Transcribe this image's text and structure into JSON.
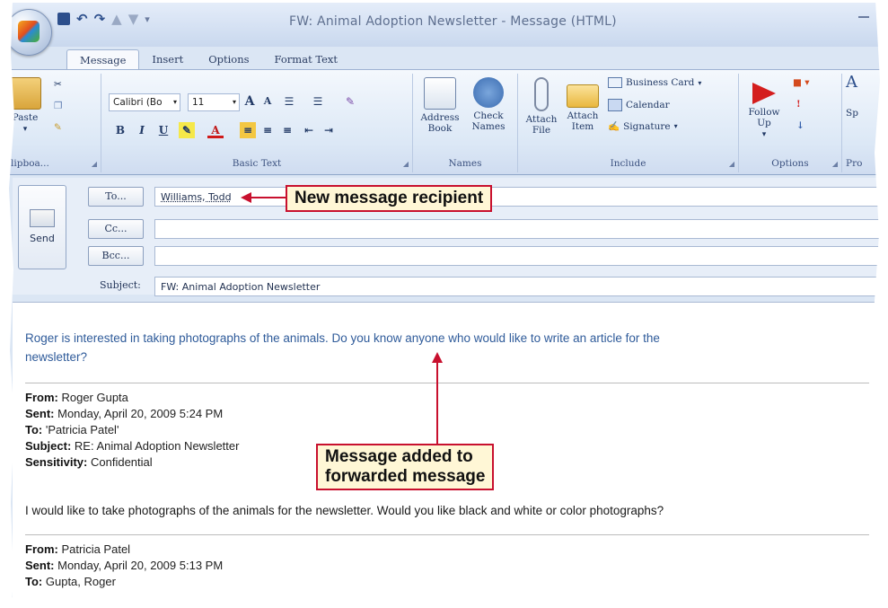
{
  "window": {
    "title": "FW: Animal Adoption Newsletter - Message (HTML)"
  },
  "qat": {
    "save_icon": "floppy-icon",
    "undo_icon": "undo-icon",
    "redo_icon": "redo-icon"
  },
  "tabs": [
    "Message",
    "Insert",
    "Options",
    "Format Text"
  ],
  "ribbon": {
    "clipboard": {
      "paste": "Paste",
      "label": "Clipboa..."
    },
    "basic_text": {
      "font": "Calibri (Bo",
      "size": "11",
      "label": "Basic Text"
    },
    "names": {
      "address_book": "Address Book",
      "check_names": "Check Names",
      "label": "Names"
    },
    "include": {
      "attach_file": "Attach File",
      "attach_item": "Attach Item",
      "business_card": "Business Card",
      "calendar": "Calendar",
      "signature": "Signature",
      "label": "Include"
    },
    "options": {
      "follow_up": "Follow Up",
      "label": "Options"
    },
    "proofing": {
      "spelling": "Sp",
      "label": "Pro"
    }
  },
  "compose": {
    "send": "Send",
    "to_button": "To...",
    "cc_button": "Cc...",
    "bcc_button": "Bcc...",
    "to_value": "Williams, Todd",
    "cc_value": "",
    "bcc_value": "",
    "subject_label": "Subject:",
    "subject_value": "FW: Animal Adoption Newsletter"
  },
  "body": {
    "added_line1": "Roger is interested in taking photographs of the animals. Do you know anyone who would like to write an article for the",
    "added_line2": "newsletter?",
    "msg1": {
      "from_label": "From:",
      "from": "Roger Gupta",
      "sent_label": "Sent:",
      "sent": "Monday, April 20, 2009 5:24 PM",
      "to_label": "To:",
      "to": "'Patricia Patel'",
      "subject_label": "Subject:",
      "subject": "RE: Animal Adoption Newsletter",
      "sensitivity_label": "Sensitivity:",
      "sensitivity": "Confidential",
      "text": "I would like to take photographs of the animals for the newsletter. Would you like black and white or color photographs?"
    },
    "msg2": {
      "from_label": "From:",
      "from": "Patricia Patel",
      "sent_label": "Sent:",
      "sent": "Monday, April 20, 2009 5:13 PM",
      "to_label": "To:",
      "to": "Gupta, Roger"
    }
  },
  "callouts": {
    "recipient": "New message recipient",
    "added_line1": "Message added to",
    "added_line2": "forwarded message"
  },
  "colors": {
    "callout_border": "#c8102e",
    "callout_fill": "#fff7d6",
    "added_text": "#2f5b9a"
  }
}
